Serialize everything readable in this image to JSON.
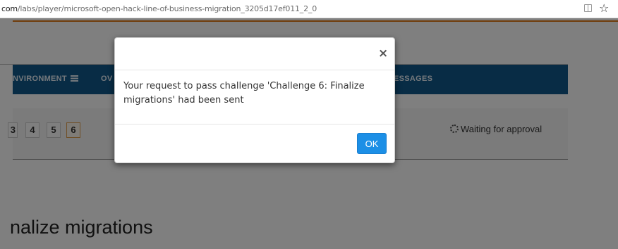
{
  "browser": {
    "url_host": "com",
    "url_path": "/labs/player/microsoft-open-hack-line-of-business-migration_3205d17ef011_2_0",
    "star_glyph": "☆"
  },
  "nav": {
    "environment_label": "NVIRONMENT",
    "overview_label": "OV",
    "messages_label": "ESSAGES"
  },
  "steps": {
    "partial": "3",
    "s4": "4",
    "s5": "5",
    "s6": "6"
  },
  "status": {
    "waiting_text": "Waiting for approval"
  },
  "main": {
    "heading": "nalize migrations"
  },
  "modal": {
    "close_glyph": "×",
    "message": "Your request to pass challenge 'Challenge 6: Finalize migrations' had been sent",
    "ok_label": "OK"
  },
  "colors": {
    "accent_orange": "#e07a17",
    "navbar_blue": "#10598a",
    "ok_blue": "#1c8fe6"
  }
}
